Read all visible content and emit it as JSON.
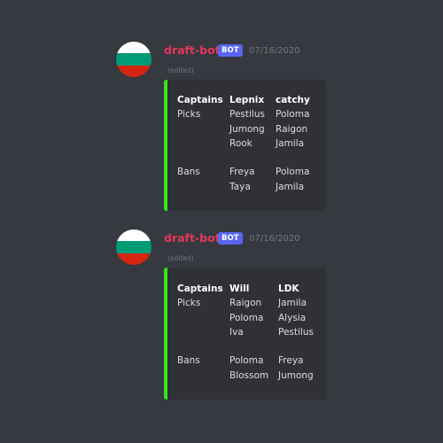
{
  "messages": [
    {
      "username": "draft-bot",
      "bot_tag": "BOT",
      "timestamp": "07/16/2020",
      "edited": "(edited)",
      "avatar_colors": [
        "#ffffff",
        "#009b77",
        "#d62612"
      ],
      "embed_color": "#33e61e",
      "embed": {
        "captions": {
          "header": "Captains",
          "picks": "Picks",
          "bans": "Bans"
        },
        "team1": {
          "name": "Lepnix",
          "picks": [
            "Pestilus",
            "Jumong",
            "Rook"
          ],
          "bans": [
            "Freya",
            "Taya"
          ]
        },
        "team2": {
          "name": "catchy",
          "picks": [
            "Poloma",
            "Raigon",
            "Jamila"
          ],
          "bans": [
            "Poloma",
            "Jamila"
          ]
        }
      }
    },
    {
      "username": "draft-bot",
      "bot_tag": "BOT",
      "timestamp": "07/16/2020",
      "edited": "(edited)",
      "avatar_colors": [
        "#ffffff",
        "#009b77",
        "#d62612"
      ],
      "embed_color": "#33e61e",
      "embed": {
        "captions": {
          "header": "Captains",
          "picks": "Picks",
          "bans": "Bans"
        },
        "team1": {
          "name": "Will",
          "picks": [
            "Raigon",
            "Poloma",
            "Iva"
          ],
          "bans": [
            "Poloma",
            "Blossom"
          ]
        },
        "team2": {
          "name": "LDK",
          "picks": [
            "Jamila",
            "Alysia",
            "Pestilus"
          ],
          "bans": [
            "Freya",
            "Jumong"
          ]
        }
      }
    }
  ]
}
